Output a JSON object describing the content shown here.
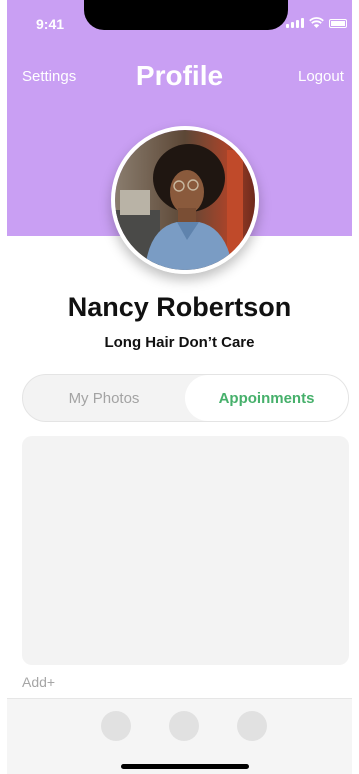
{
  "status_bar": {
    "time": "9:41"
  },
  "header": {
    "settings_label": "Settings",
    "title": "Profile",
    "logout_label": "Logout"
  },
  "profile": {
    "name": "Nancy Robertson",
    "bio": "Long Hair Don’t Care"
  },
  "segments": {
    "items": [
      {
        "label": "My Photos",
        "selected": false
      },
      {
        "label": "Appoinments",
        "selected": true
      }
    ]
  },
  "content": {
    "add_label": "Add+"
  },
  "colors": {
    "header_bg": "#c99ff3",
    "accent_green": "#46b06b",
    "muted_text": "#a3a3a3"
  },
  "icons": [
    "signal-icon",
    "wifi-icon",
    "battery-icon",
    "tab-icon-1",
    "tab-icon-2",
    "tab-icon-3"
  ]
}
